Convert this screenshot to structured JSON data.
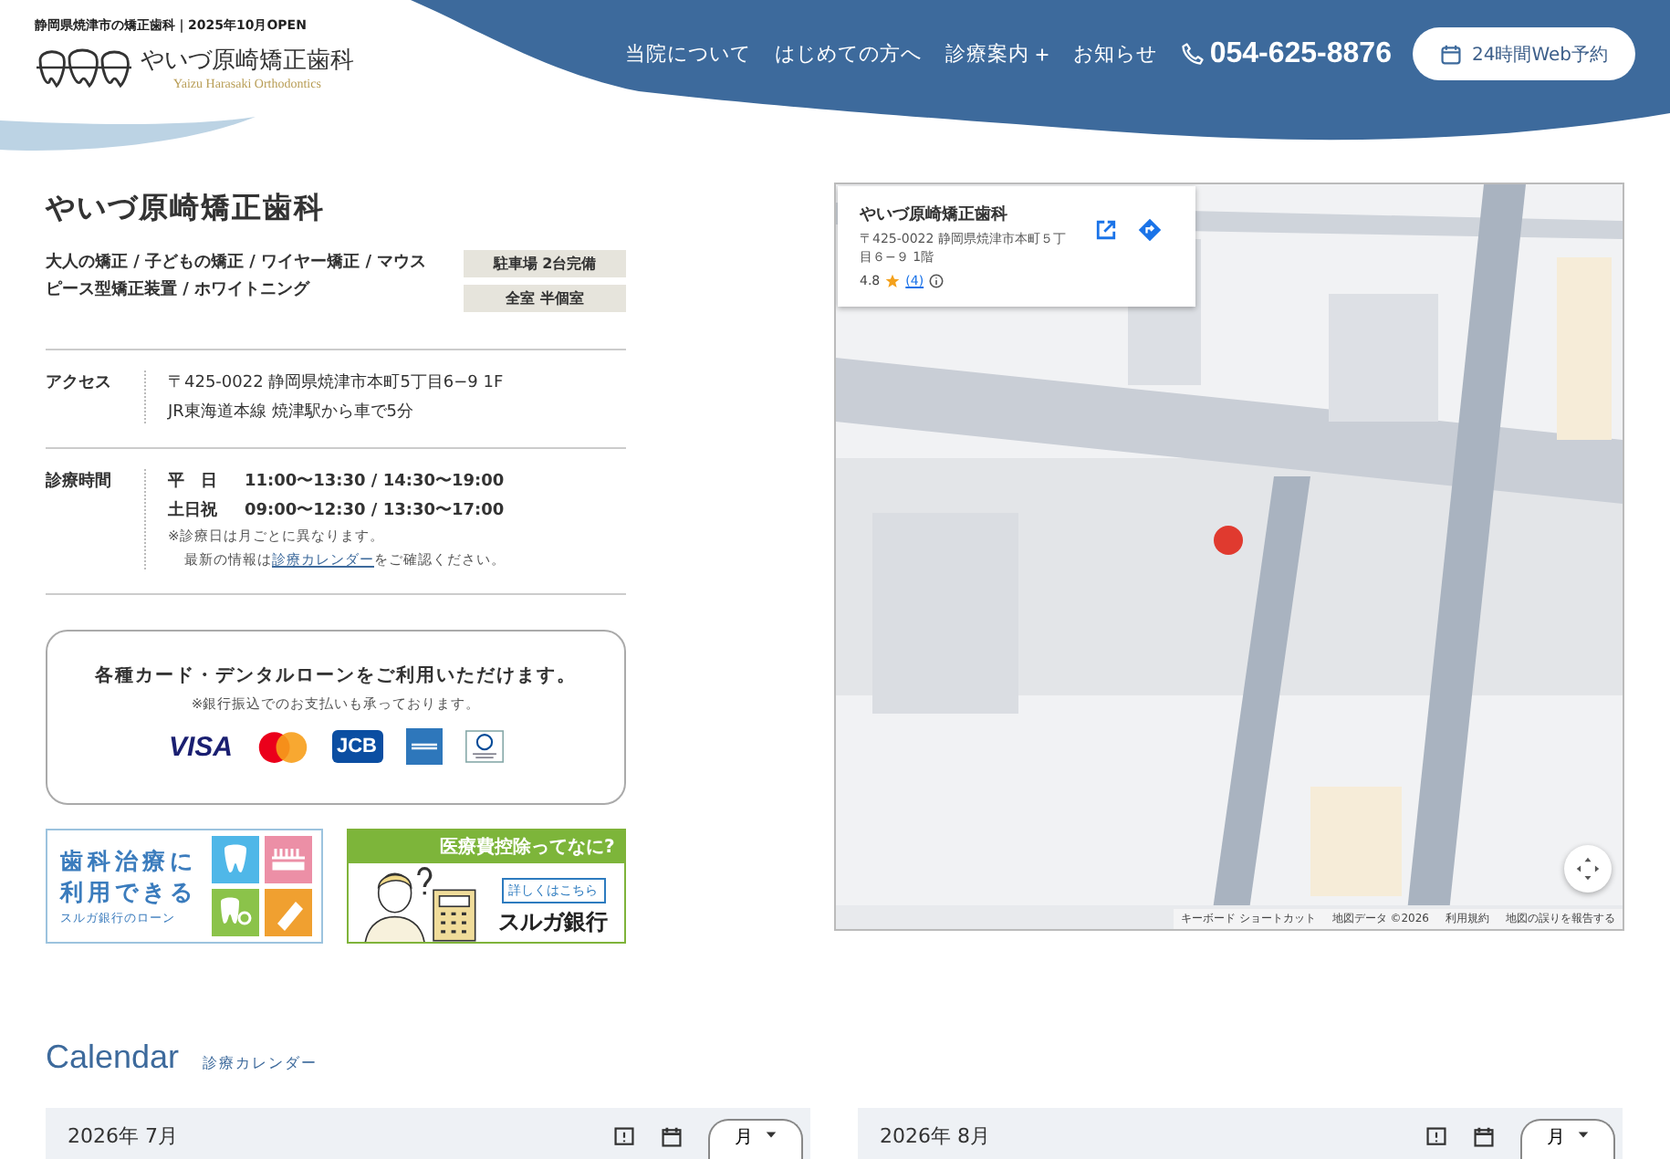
{
  "header": {
    "tagline": "静岡県焼津市の矯正歯科｜2025年10月OPEN",
    "logo_name": "やいづ原崎矯正歯科",
    "logo_sub": "Yaizu Harasaki Orthodontics",
    "nav": [
      {
        "label": "当院について",
        "has_submenu": false
      },
      {
        "label": "はじめての方へ",
        "has_submenu": false
      },
      {
        "label": "診療案内",
        "has_submenu": true
      },
      {
        "label": "お知らせ",
        "has_submenu": false
      }
    ],
    "phone": "054-625-8876",
    "reserve_button": "24時間Web予約"
  },
  "clinic": {
    "name": "やいづ原崎矯正歯科",
    "treatments": "大人の矯正 / 子どもの矯正 / ワイヤー矯正 / マウスピース型矯正装置 / ホワイトニング",
    "badges": [
      "駐車場 2台完備",
      "全室 半個室"
    ],
    "access": {
      "label": "アクセス",
      "lines": [
        "〒425-0022 静岡県焼津市本町5丁目6−9 1F",
        "JR東海道本線 焼津駅から車で5分"
      ]
    },
    "hours": {
      "label": "診療時間",
      "rows": [
        {
          "day": "平　日",
          "time": "11:00〜13:30 / 14:30〜19:00"
        },
        {
          "day": "土日祝",
          "time": "09:00〜12:30 / 13:30〜17:00"
        }
      ],
      "note": "※診療日は月ごとに異なります。",
      "latest_prefix": "最新の情報は",
      "latest_link": "診療カレンダー",
      "latest_suffix": "をご確認ください。"
    }
  },
  "payment": {
    "title": "各種カード・デンタルローンをご利用いただけます。",
    "note": "※銀行振込でのお支払いも承っております。",
    "cards": [
      {
        "kind": "visa",
        "label": "VISA"
      },
      {
        "kind": "mastercard"
      },
      {
        "kind": "jcb",
        "label": "JCB"
      },
      {
        "kind": "amex"
      },
      {
        "kind": "diners"
      }
    ]
  },
  "banners": {
    "loan": {
      "lines": [
        "歯科治療に",
        "利用できる"
      ],
      "sub": "スルガ銀行のローン"
    },
    "tax": {
      "title": "医療費控除ってなに?",
      "button": "詳しくはこちら",
      "bank": "スルガ銀行"
    }
  },
  "map": {
    "card": {
      "name": "やいづ原崎矯正歯科",
      "address": "〒425-0022 静岡県焼津市本町５丁目６−９ 1階",
      "rating": "4.8",
      "reviews": "(4)"
    },
    "attribution": [
      "キーボード ショートカット",
      "地図データ ©2026",
      "利用規約",
      "地図の誤りを報告する"
    ]
  },
  "calendar": {
    "title": "Calendar",
    "subtitle": "診療カレンダー",
    "months": [
      {
        "label": "2026年 7月",
        "view": "月"
      },
      {
        "label": "2026年 8月",
        "view": "月"
      }
    ]
  }
}
